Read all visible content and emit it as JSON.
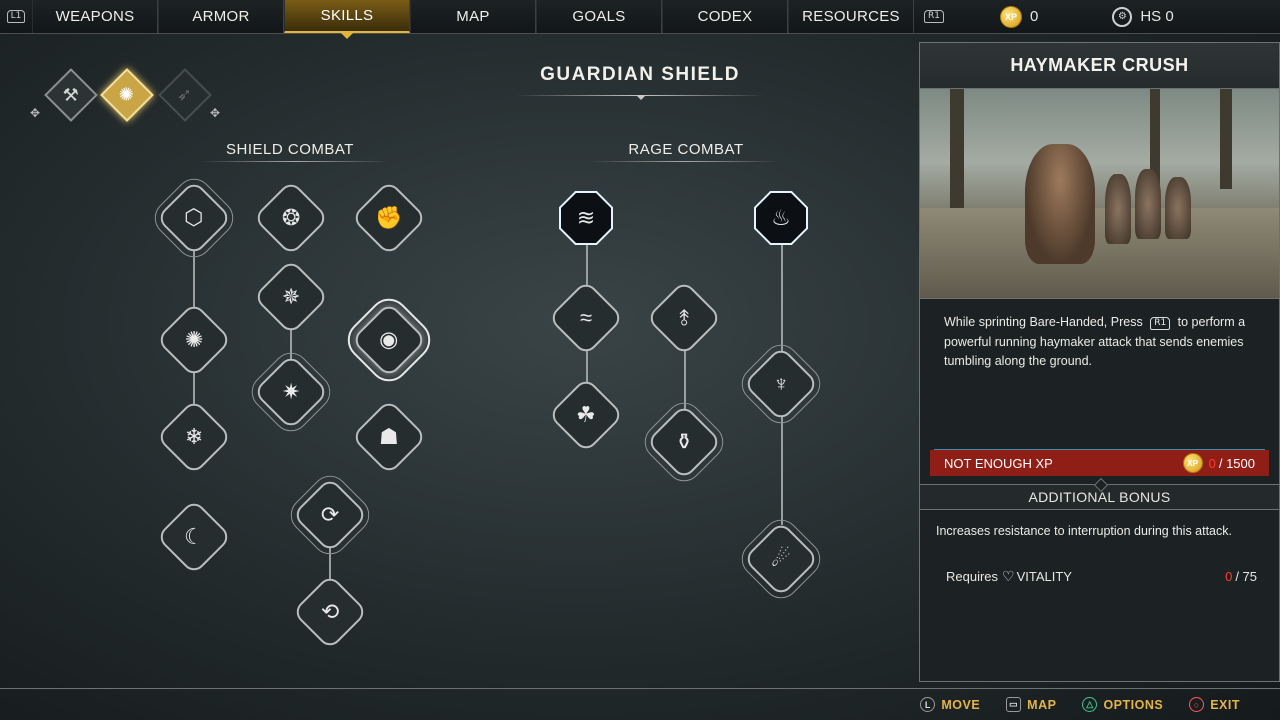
{
  "topbar": {
    "left_bumper": "L1",
    "right_bumper": "R1",
    "tabs": [
      {
        "label": "WEAPONS"
      },
      {
        "label": "ARMOR"
      },
      {
        "label": "SKILLS"
      },
      {
        "label": "MAP"
      },
      {
        "label": "GOALS"
      },
      {
        "label": "CODEX"
      },
      {
        "label": "RESOURCES"
      }
    ],
    "active_tab": "SKILLS",
    "xp_badge": "XP",
    "xp_value": "0",
    "hs_label": "HS 0"
  },
  "tree": {
    "title": "GUARDIAN SHIELD",
    "categories": [
      {
        "icon": "axe-icon"
      },
      {
        "icon": "shield-icon",
        "active": true
      },
      {
        "icon": "bow-icon",
        "dim": true
      }
    ],
    "sections": [
      "SHIELD COMBAT",
      "RAGE COMBAT"
    ]
  },
  "detail": {
    "title": "HAYMAKER CRUSH",
    "description_1": "While sprinting Bare-Handed, Press",
    "button": "R1",
    "description_2": "to perform a powerful running haymaker attack that sends enemies tumbling along the ground.",
    "xp_status": "NOT ENOUGH XP",
    "xp_badge": "XP",
    "xp_current": "0",
    "xp_required": "/ 1500",
    "bonus_header": "ADDITIONAL BONUS",
    "bonus_text": "Increases resistance to interruption during this attack.",
    "requires_label": "Requires",
    "requires_stat": "VITALITY",
    "requires_current": "0",
    "requires_total": "/ 75"
  },
  "hints": [
    {
      "key": "L",
      "label": "MOVE"
    },
    {
      "key": "▭",
      "label": "MAP"
    },
    {
      "key": "△",
      "label": "OPTIONS"
    },
    {
      "key": "○",
      "label": "EXIT"
    }
  ],
  "colors": {
    "accent_gold": "#e3b43b",
    "warning_red": "#8f1e17",
    "xp_red": "#ff3b30",
    "skill_glow": "#9fd6ff"
  }
}
